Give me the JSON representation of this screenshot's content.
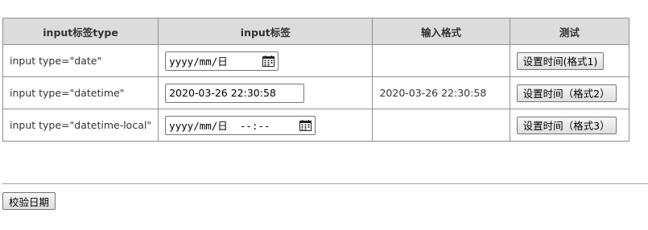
{
  "table": {
    "headers": [
      "input标签type",
      "input标签",
      "输入格式",
      "测试"
    ],
    "rows": [
      {
        "type_label": "input type=\"date\"",
        "input_value": "yyyy/mm/日",
        "input_kind": "date",
        "format": "",
        "button_label": "设置时间(格式1)"
      },
      {
        "type_label": "input type=\"datetime\"",
        "input_value": "2020-03-26 22:30:58",
        "input_kind": "text",
        "format": "2020-03-26 22:30:58",
        "button_label": "设置时间（格式2）"
      },
      {
        "type_label": "input type=\"datetime-local\"",
        "input_value": "yyyy/mm/日  --:--",
        "input_kind": "datetime-local",
        "format": "",
        "button_label": "设置时间（格式3）"
      }
    ]
  },
  "verify_button": "校验日期",
  "colors": {
    "header_bg": "#dcdcdc",
    "border": "#8f8f8f",
    "text": "#333333"
  },
  "icons": {
    "calendar": "calendar-icon"
  }
}
